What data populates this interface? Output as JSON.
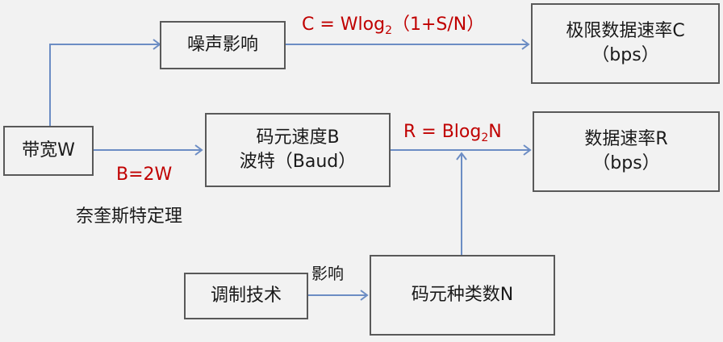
{
  "boxes": {
    "bandwidth": "带宽W",
    "noise": "噪声影响",
    "limit_rate": {
      "line1": "极限数据速率C",
      "line2": "（bps）"
    },
    "symbol_rate": {
      "line1": "码元速度B",
      "line2": "波特（Baud）"
    },
    "data_rate": {
      "line1": "数据速率R",
      "line2": "（bps）"
    },
    "modulation": "调制技术",
    "symbol_types": "码元种类数N"
  },
  "labels": {
    "shannon": {
      "pre": "C = Wlog",
      "sub": "2",
      "post": "（1+S/N）"
    },
    "nyquist_formula": "B=2W",
    "nyquist_theorem": "奈奎斯特定理",
    "rate_formula": {
      "pre": "R = Blog",
      "sub": "2",
      "post": "N"
    },
    "affects": "影响"
  },
  "colors": {
    "formula": "#c00000",
    "border": "#595959",
    "arrow": "#6c8dc4",
    "background": "#f2f2f2"
  }
}
